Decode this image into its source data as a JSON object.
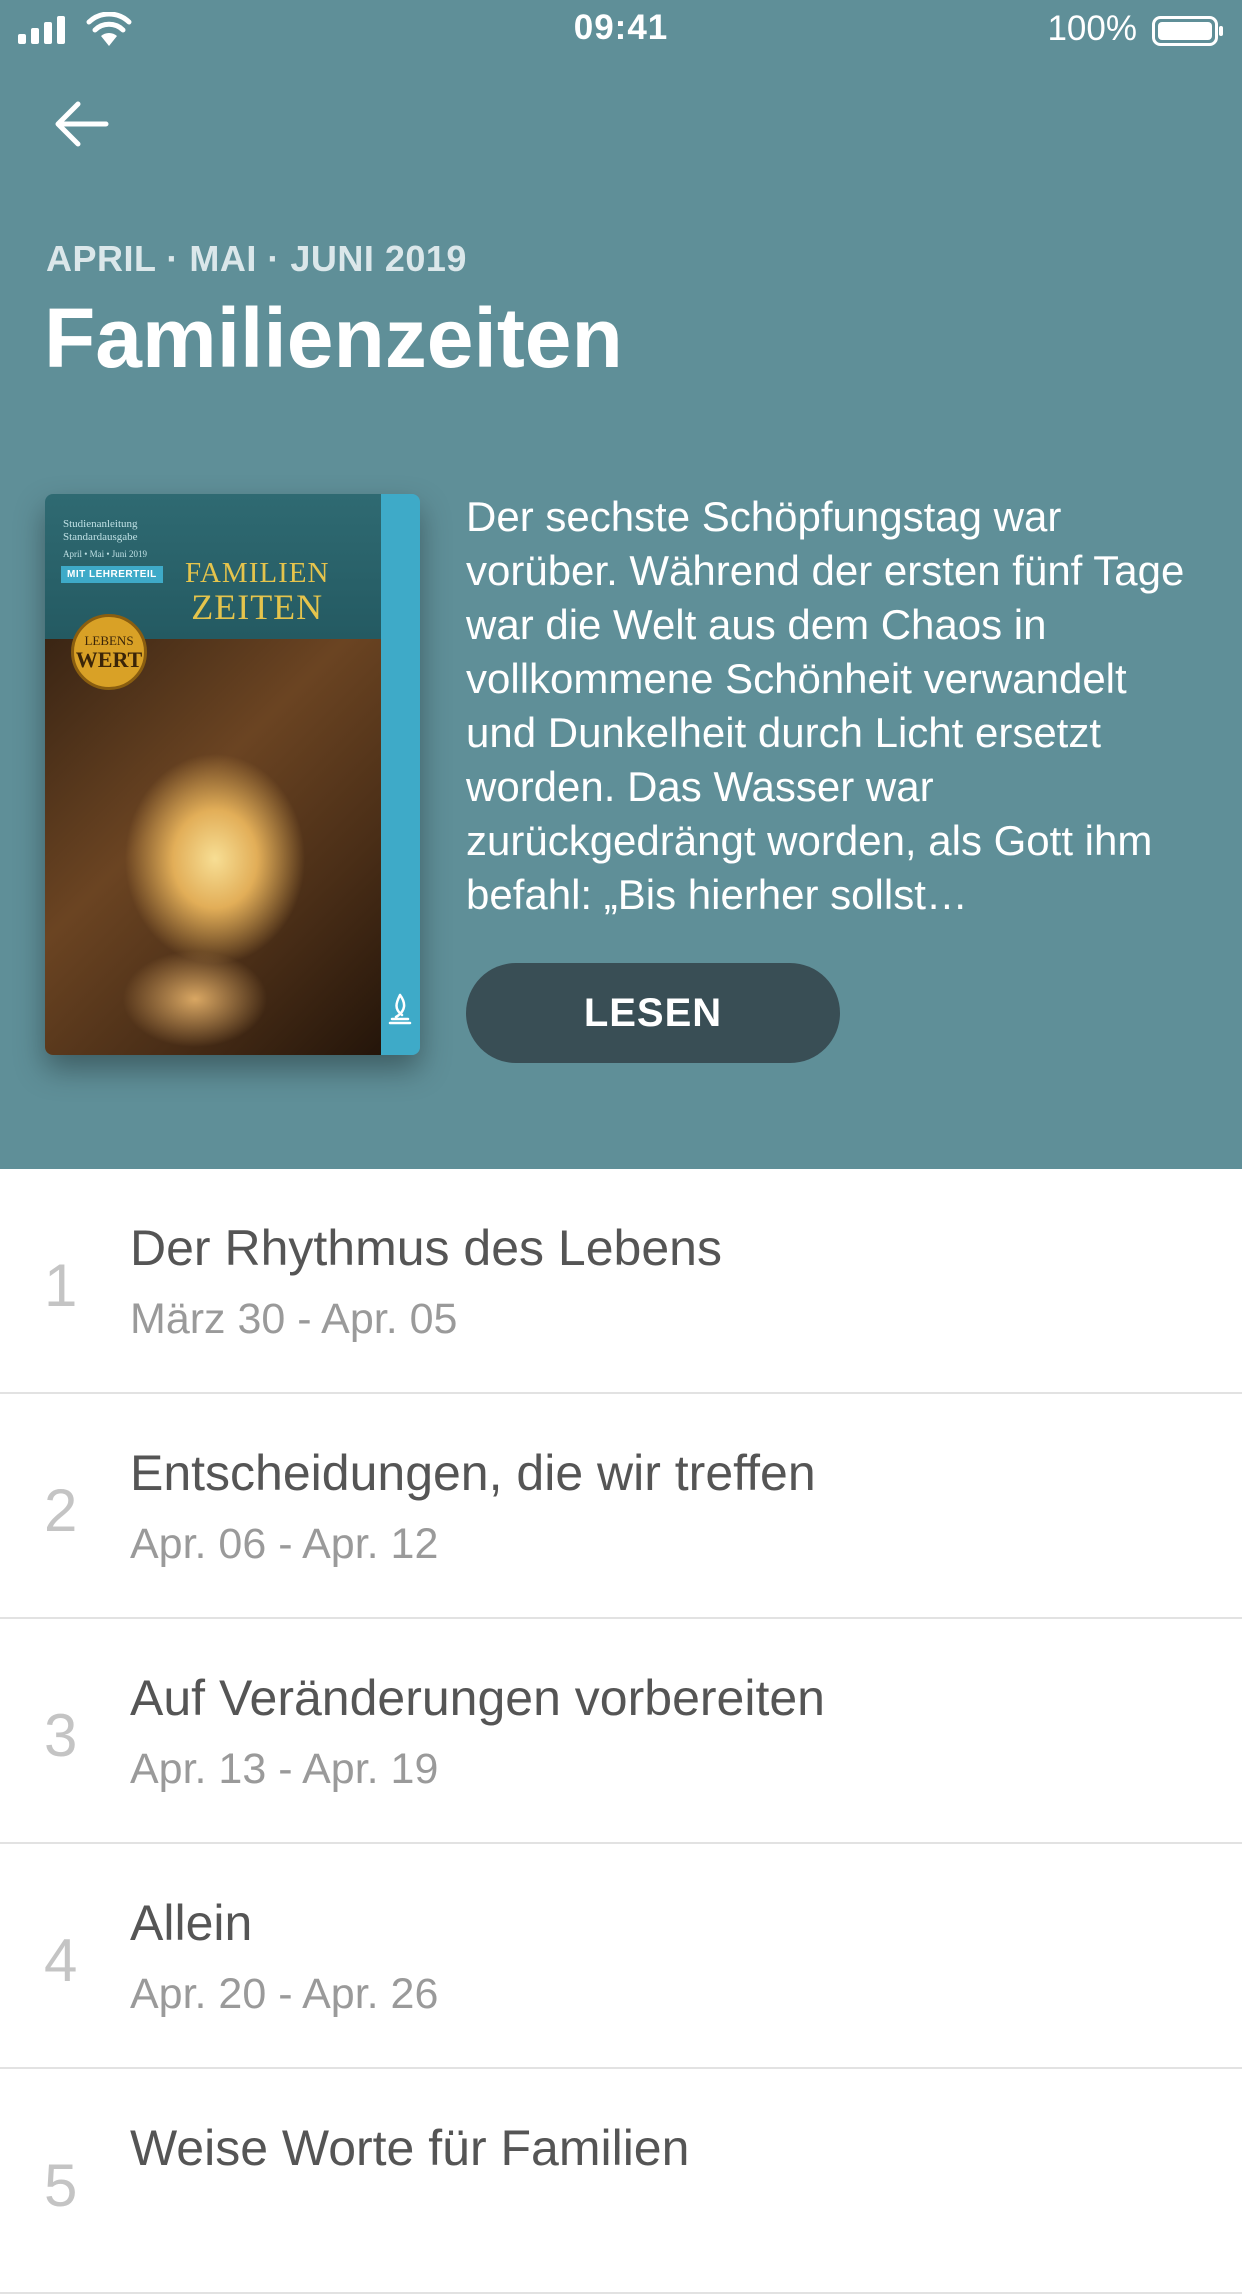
{
  "status_bar": {
    "time": "09:41",
    "battery": "100%"
  },
  "header": {
    "back_icon": "arrow-left-icon",
    "quarter": "APRIL · MAI · JUNI 2019",
    "title": "Familienzeiten"
  },
  "cover": {
    "small_line_1": "Studienanleitung",
    "small_line_2": "Standardausgabe",
    "small_line_3": "April • Mai • Juni 2019",
    "badge": "MIT LEHRERTEIL",
    "title_line_1": "FAMILIEN",
    "title_line_2": "ZEITEN",
    "seal_line_1": "LEBENS",
    "seal_line_2": "WERT"
  },
  "summary": "Der sechste Schöpfungstag war vorüber. Während der ersten fünf Tage war die Welt aus dem Chaos in vollkommene Schönheit verwandelt und Dunkelheit durch Licht ersetzt worden. Das Wasser war zurückgedrängt worden, als Gott ihm befahl: „Bis hierher sollst…",
  "read_button": "LESEN",
  "lessons": [
    {
      "number": "1",
      "title": "Der Rhythmus des Lebens",
      "dates": "März 30 - Apr. 05"
    },
    {
      "number": "2",
      "title": "Entscheidungen, die wir treffen",
      "dates": "Apr. 06 - Apr. 12"
    },
    {
      "number": "3",
      "title": "Auf Veränderungen vorbereiten",
      "dates": "Apr. 13 - Apr. 19"
    },
    {
      "number": "4",
      "title": "Allein",
      "dates": "Apr. 20 - Apr. 26"
    },
    {
      "number": "5",
      "title": "Weise Worte für Familien",
      "dates": ""
    }
  ],
  "colors": {
    "hero": "#5f8f98",
    "button": "#394e55",
    "accent": "#3eaac8"
  }
}
